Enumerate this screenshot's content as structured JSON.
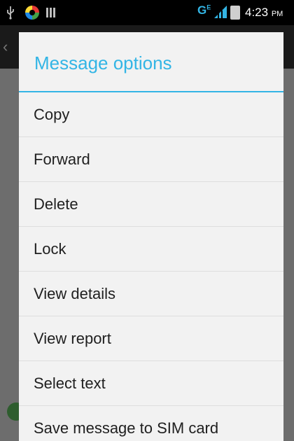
{
  "status_bar": {
    "network_type": "G",
    "network_sup": "E",
    "time": "4:23",
    "ampm": "PM",
    "icons": [
      "usb-icon",
      "app-notification-icon",
      "bars-icon",
      "signal-icon",
      "battery-icon"
    ]
  },
  "dialog": {
    "title": "Message options",
    "accent_color": "#33b5e5",
    "items": [
      {
        "label": "Copy"
      },
      {
        "label": "Forward"
      },
      {
        "label": "Delete"
      },
      {
        "label": "Lock"
      },
      {
        "label": "View details"
      },
      {
        "label": "View report"
      },
      {
        "label": "Select text"
      },
      {
        "label": "Save message to SIM card"
      }
    ]
  }
}
